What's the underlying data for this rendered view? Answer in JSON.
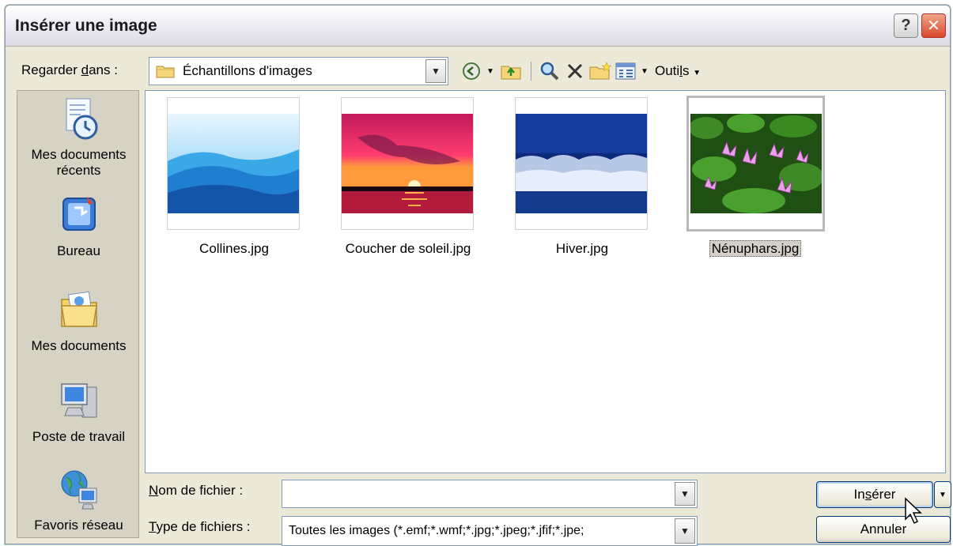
{
  "window": {
    "title": "Insérer une image"
  },
  "titlebar": {
    "help_label": "?",
    "close_label": "✕"
  },
  "lookin": {
    "label_pre": "Regarder ",
    "label_key": "d",
    "label_post": "ans :",
    "value": "Échantillons d'images"
  },
  "toolbar": {
    "back_icon": "back-icon",
    "up_icon": "up-folder-icon",
    "search_icon": "search-web-icon",
    "delete_icon": "delete-icon",
    "newfolder_icon": "new-folder-icon",
    "views_icon": "views-icon",
    "tools_pre": "Outi",
    "tools_key": "l",
    "tools_post": "s"
  },
  "places": [
    {
      "label": "Mes documents récents",
      "icon": "recent-documents-icon"
    },
    {
      "label": "Bureau",
      "icon": "desktop-icon"
    },
    {
      "label": "Mes documents",
      "icon": "my-documents-icon"
    },
    {
      "label": "Poste de travail",
      "icon": "my-computer-icon"
    },
    {
      "label": "Favoris réseau",
      "icon": "network-places-icon"
    }
  ],
  "files": [
    {
      "name": "Collines.jpg",
      "selected": false
    },
    {
      "name": "Coucher de soleil.jpg",
      "selected": false
    },
    {
      "name": "Hiver.jpg",
      "selected": false
    },
    {
      "name": "Nénuphars.jpg",
      "selected": true
    }
  ],
  "filename": {
    "label_key": "N",
    "label_post": "om de fichier :",
    "value": ""
  },
  "filetype": {
    "label_key": "T",
    "label_post": "ype de fichiers :",
    "value": "Toutes les images (*.emf;*.wmf;*.jpg;*.jpeg;*.jfif;*.jpe;"
  },
  "buttons": {
    "insert_pre": "In",
    "insert_key": "s",
    "insert_post": "érer",
    "cancel": "Annuler"
  },
  "colors": {
    "dialog_bg": "#ece9d8",
    "accent_border": "#7f9db9",
    "close_red": "#d9482a"
  }
}
